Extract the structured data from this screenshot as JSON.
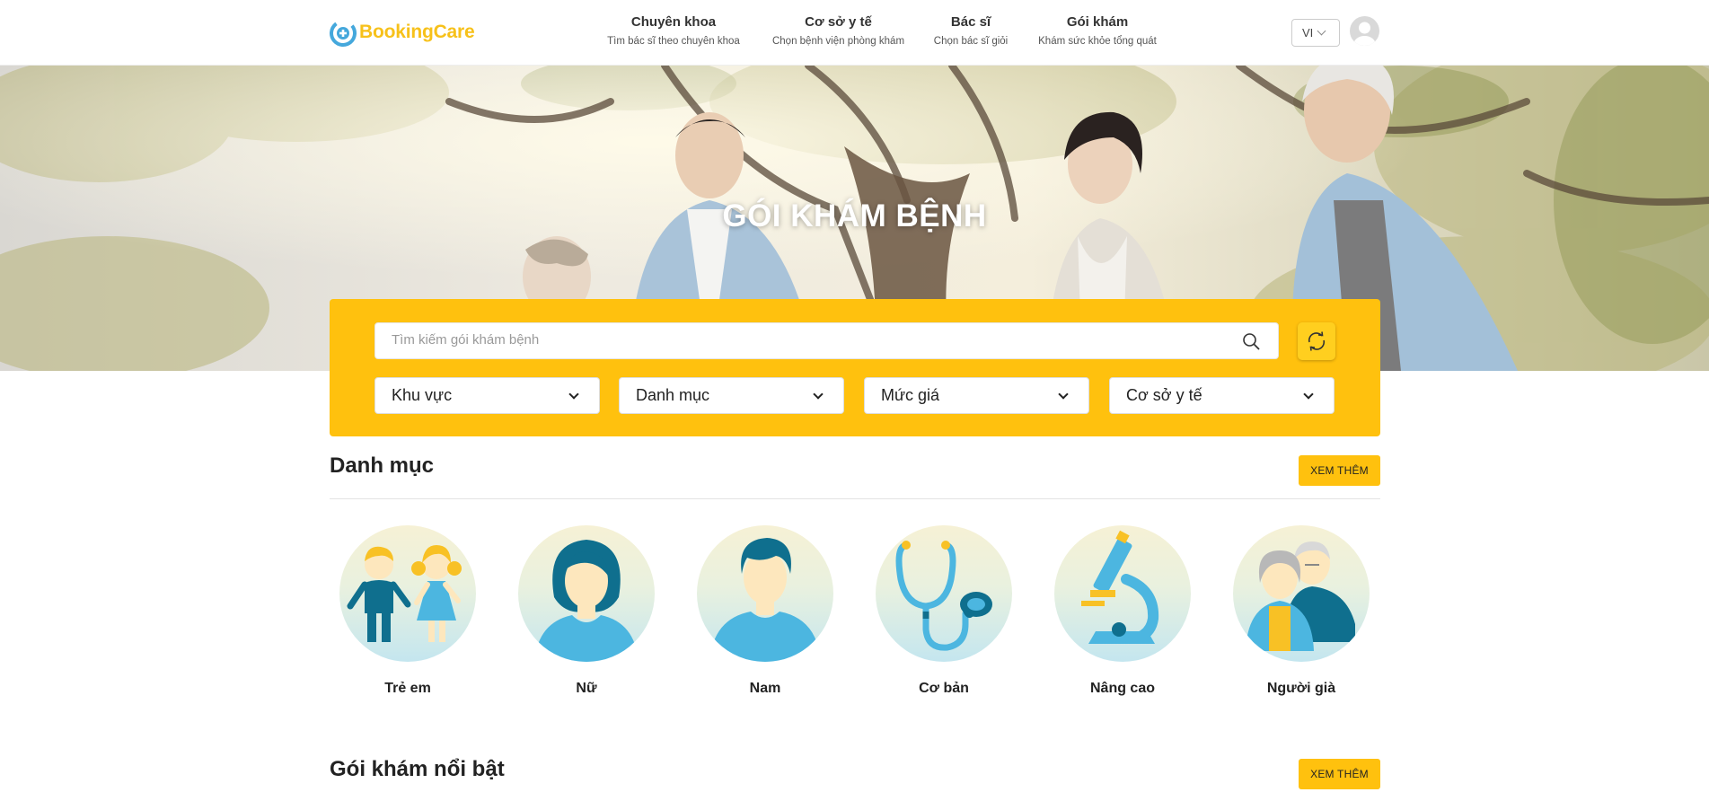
{
  "header": {
    "logo_text": "BookingCare",
    "nav": [
      {
        "title": "Chuyên khoa",
        "subtitle": "Tìm bác sĩ theo chuyên khoa"
      },
      {
        "title": "Cơ sở y tế",
        "subtitle": "Chọn bệnh viện phòng khám"
      },
      {
        "title": "Bác sĩ",
        "subtitle": "Chọn bác sĩ giỏi"
      },
      {
        "title": "Gói khám",
        "subtitle": "Khám sức khỏe tổng quát"
      }
    ],
    "language": "VI",
    "icons": {
      "avatar": "user-avatar-icon",
      "language_dropdown": "chevron-down-icon"
    }
  },
  "banner": {
    "title": "GÓI KHÁM BỆNH"
  },
  "search": {
    "placeholder": "Tìm kiếm gói khám bệnh",
    "filters": [
      "Khu vực",
      "Danh mục",
      "Mức giá",
      "Cơ sở y tế"
    ],
    "icons": {
      "search": "search-icon",
      "refresh": "refresh-icon"
    }
  },
  "categories_section": {
    "title": "Danh mục",
    "more_label": "XEM THÊM",
    "items": [
      {
        "label": "Trẻ em",
        "icon": "children-icon"
      },
      {
        "label": "Nữ",
        "icon": "woman-icon"
      },
      {
        "label": "Nam",
        "icon": "man-icon"
      },
      {
        "label": "Cơ bản",
        "icon": "stethoscope-icon"
      },
      {
        "label": "Nâng cao",
        "icon": "microscope-icon"
      },
      {
        "label": "Người già",
        "icon": "elderly-couple-icon"
      }
    ]
  },
  "featured_section": {
    "title": "Gói khám nổi bật",
    "more_label": "XEM THÊM"
  },
  "colors": {
    "brand_yellow": "#ffc10e",
    "logo_blue": "#45a8dc",
    "illustration_dark_blue": "#0f6f8e",
    "illustration_light_blue": "#4cb6e0"
  }
}
